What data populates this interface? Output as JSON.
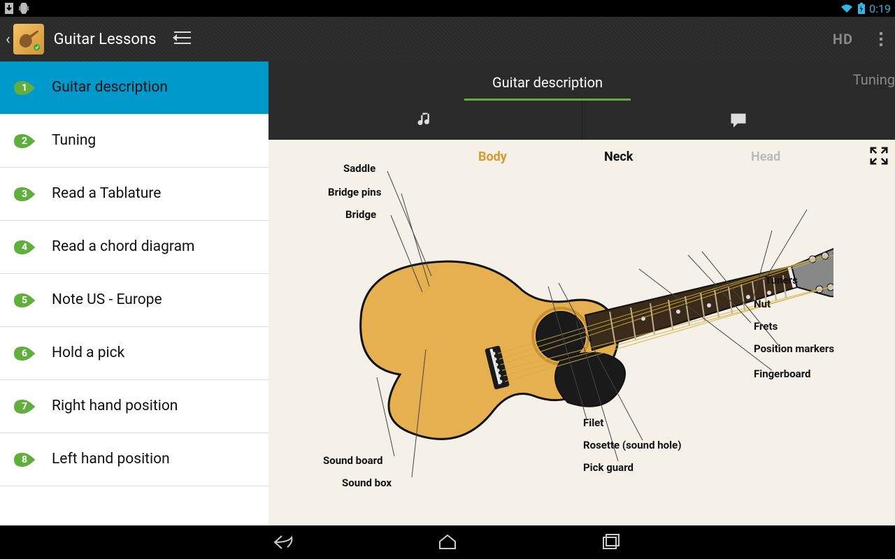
{
  "status": {
    "time": "0:19"
  },
  "header": {
    "title": "Guitar Lessons",
    "hd_label": "HD"
  },
  "sidebar": {
    "items": [
      {
        "num": "1",
        "label": "Guitar description",
        "active": true
      },
      {
        "num": "2",
        "label": "Tuning"
      },
      {
        "num": "3",
        "label": "Read a Tablature"
      },
      {
        "num": "4",
        "label": "Read a chord diagram"
      },
      {
        "num": "5",
        "label": "Note US - Europe"
      },
      {
        "num": "6",
        "label": "Hold a pick"
      },
      {
        "num": "7",
        "label": "Right hand position"
      },
      {
        "num": "8",
        "label": "Left hand position"
      }
    ]
  },
  "content": {
    "tabs": {
      "active": "Guitar description",
      "next": "Tuning"
    },
    "sections": {
      "body": "Body",
      "neck": "Neck",
      "head": "Head"
    },
    "parts": {
      "saddle": "Saddle",
      "bridge_pins": "Bridge pins",
      "bridge": "Bridge",
      "sound_board": "Sound board",
      "sound_box": "Sound box",
      "filet": "Filet",
      "rosette": "Rosette (sound hole)",
      "pick_guard": "Pick guard",
      "tuners": "Tuners",
      "nut": "Nut",
      "frets": "Frets",
      "position_markers": "Position markers",
      "fingerboard": "Fingerboard"
    }
  }
}
